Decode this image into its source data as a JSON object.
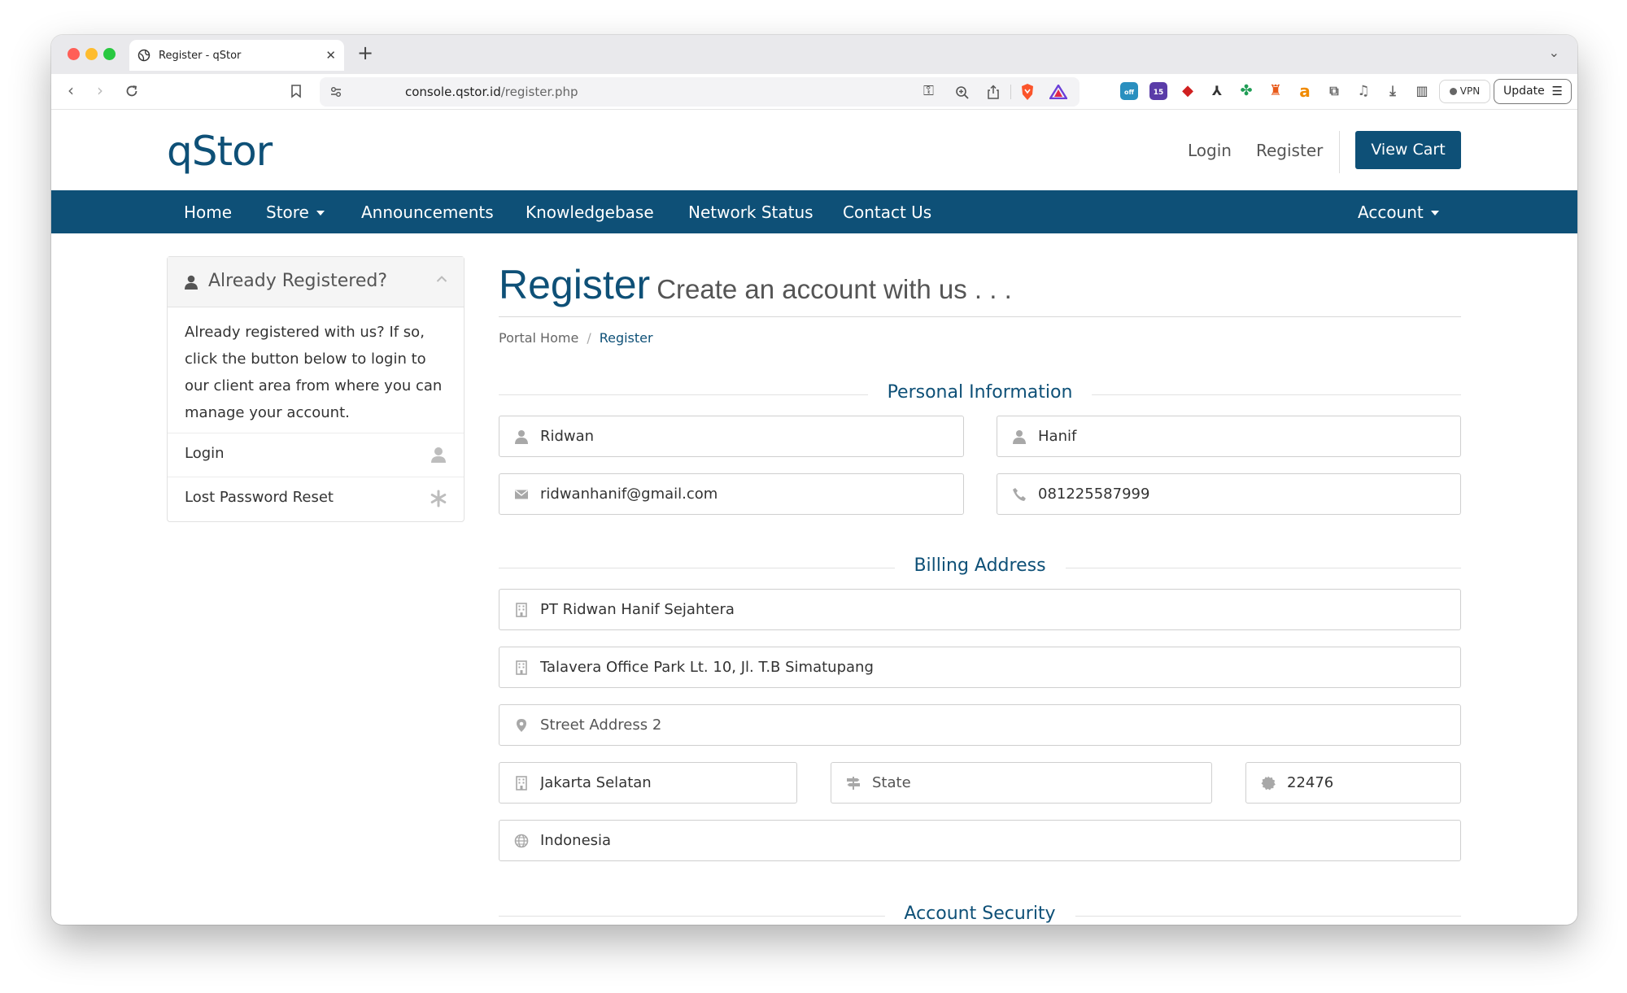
{
  "browser": {
    "tab_title": "Register - qStor",
    "url_domain": "console.qstor.id",
    "url_path": "/register.php",
    "vpn_label": "VPN",
    "update_label": "Update",
    "extension_badge_count": "15",
    "extension_off_label": "off"
  },
  "header": {
    "logo": "qStor",
    "login": "Login",
    "register": "Register",
    "view_cart": "View Cart"
  },
  "nav": {
    "items": [
      "Home",
      "Store",
      "Announcements",
      "Knowledgebase",
      "Network Status",
      "Contact Us"
    ],
    "account": "Account"
  },
  "sidebar": {
    "title": "Already Registered?",
    "body": "Already registered with us? If so, click the button below to login to our client area from where you can manage your account.",
    "links": [
      "Login",
      "Lost Password Reset"
    ]
  },
  "main": {
    "title": "Register",
    "subtitle": "Create an account with us . . .",
    "breadcrumb": [
      "Portal Home",
      "/",
      "Register"
    ]
  },
  "sections": {
    "personal": "Personal Information",
    "billing": "Billing Address",
    "security": "Account Security"
  },
  "fields": {
    "first_name": "Ridwan",
    "last_name": "Hanif",
    "email": "ridwanhanif@gmail.com",
    "phone": "081225587999",
    "company": "PT Ridwan Hanif Sejahtera",
    "address1": "Talavera Office Park Lt. 10, Jl. T.B Simatupang",
    "address2_placeholder": "Street Address 2",
    "city": "Jakarta Selatan",
    "state_placeholder": "State",
    "postcode": "22476",
    "country": "Indonesia"
  },
  "colors": {
    "brand": "#0e5077",
    "nav_bg": "#0e5077",
    "border": "#cfcfcf",
    "icon_gray": "#a8a8a8"
  }
}
